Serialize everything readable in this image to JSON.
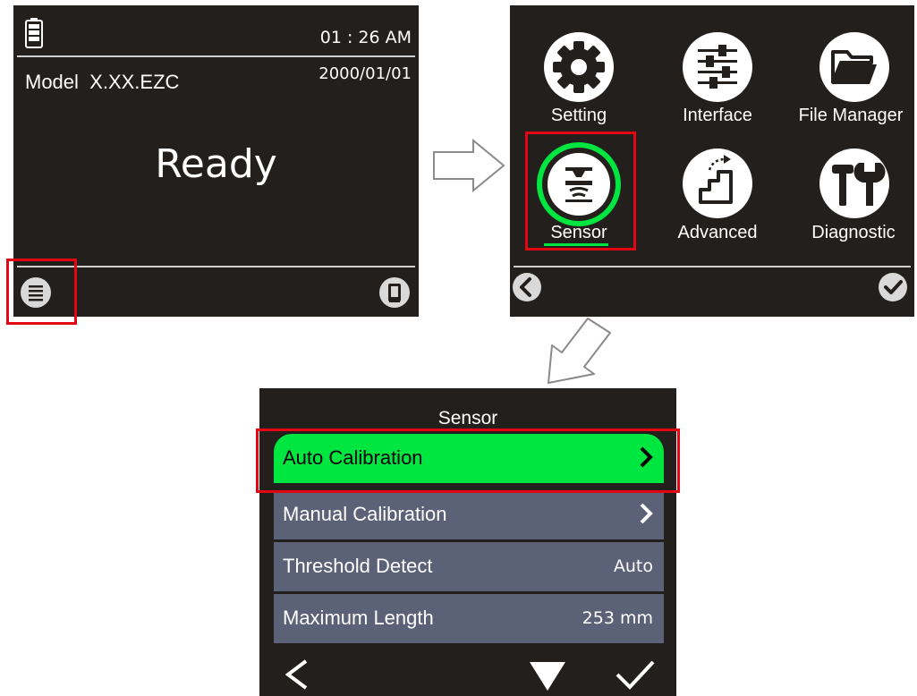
{
  "home_screen": {
    "time": "01 : 26 AM",
    "date": "2000/01/01",
    "model_label": "Model",
    "model_value": "X.XX.EZC",
    "status": "Ready"
  },
  "main_menu": {
    "items": [
      {
        "label": "Setting",
        "icon": "gear-icon"
      },
      {
        "label": "Interface",
        "icon": "sliders-icon"
      },
      {
        "label": "File Manager",
        "icon": "folder-icon"
      },
      {
        "label": "Sensor",
        "icon": "sensor-icon"
      },
      {
        "label": "Advanced",
        "icon": "stairs-icon"
      },
      {
        "label": "Diagnostic",
        "icon": "tools-icon"
      }
    ],
    "selected": "Sensor"
  },
  "sensor_screen": {
    "title": "Sensor",
    "items": [
      {
        "label": "Auto Calibration",
        "value": ""
      },
      {
        "label": "Manual Calibration",
        "value": ""
      },
      {
        "label": "Threshold Detect",
        "value": "Auto"
      },
      {
        "label": "Maximum Length",
        "value": "253 mm"
      }
    ]
  },
  "colors": {
    "screen_bg": "#231f1c",
    "highlight": "#00e640",
    "row_bg": "#5b6176",
    "callout": "#e30613"
  }
}
